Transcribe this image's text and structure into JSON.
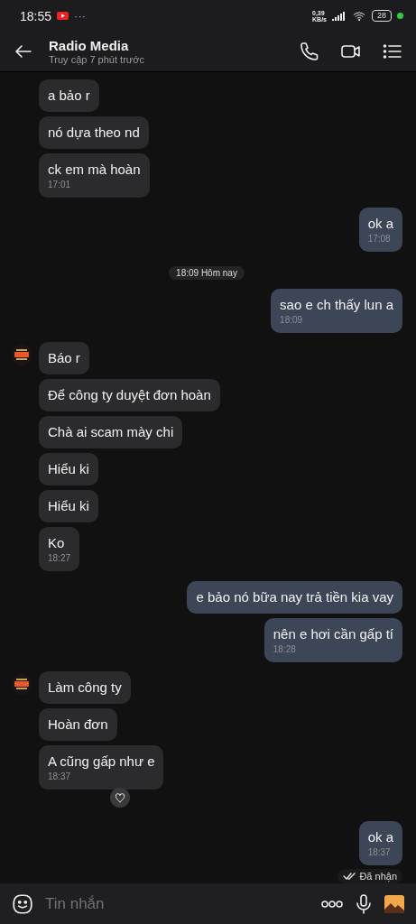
{
  "status_bar": {
    "time": "18:55",
    "more": "···",
    "speed_value": "0,39",
    "speed_unit": "KB/s",
    "battery": "28"
  },
  "header": {
    "title": "Radio Media",
    "subtitle": "Truy cập 7 phút trước"
  },
  "messages": [
    {
      "kind": "message",
      "outgoing": false,
      "text": "a bảo r",
      "avatar": false
    },
    {
      "kind": "message",
      "outgoing": false,
      "text": "nó dựa theo nd",
      "avatar": false
    },
    {
      "kind": "message",
      "outgoing": false,
      "text": "ck em mà hoàn",
      "time": "17:01",
      "avatar": false
    },
    {
      "kind": "message",
      "outgoing": true,
      "text": "ok a",
      "time": "17:08"
    },
    {
      "kind": "separator",
      "text": "18:09 Hôm nay"
    },
    {
      "kind": "message",
      "outgoing": true,
      "text": "sao e ch thấy lun a",
      "time": "18:09"
    },
    {
      "kind": "message",
      "outgoing": false,
      "text": "Báo r",
      "avatar": true
    },
    {
      "kind": "message",
      "outgoing": false,
      "text": "Để công ty duyệt đơn hoàn",
      "avatar": false
    },
    {
      "kind": "message",
      "outgoing": false,
      "text": "Chà ai scam mày chi",
      "avatar": false
    },
    {
      "kind": "message",
      "outgoing": false,
      "text": "Hiểu ki",
      "avatar": false
    },
    {
      "kind": "message",
      "outgoing": false,
      "text": "Hiểu ki",
      "avatar": false
    },
    {
      "kind": "message",
      "outgoing": false,
      "text": "Ko",
      "time": "18:27",
      "avatar": false
    },
    {
      "kind": "message",
      "outgoing": true,
      "text": "e bảo nó bữa nay trả tiền kia vay"
    },
    {
      "kind": "message",
      "outgoing": true,
      "text": "nên e hơi cần gấp tí",
      "time": "18:28"
    },
    {
      "kind": "message",
      "outgoing": false,
      "text": "Làm công ty",
      "avatar": true
    },
    {
      "kind": "message",
      "outgoing": false,
      "text": "Hoàn đơn",
      "avatar": false
    },
    {
      "kind": "message",
      "outgoing": false,
      "text": "A cũng gấp như e",
      "time": "18:37",
      "avatar": false,
      "reaction": true
    },
    {
      "kind": "message",
      "outgoing": true,
      "text": "ok a",
      "time": "18:37",
      "receipt": "Đã nhận"
    }
  ],
  "composer": {
    "placeholder": "Tin nhắn"
  }
}
